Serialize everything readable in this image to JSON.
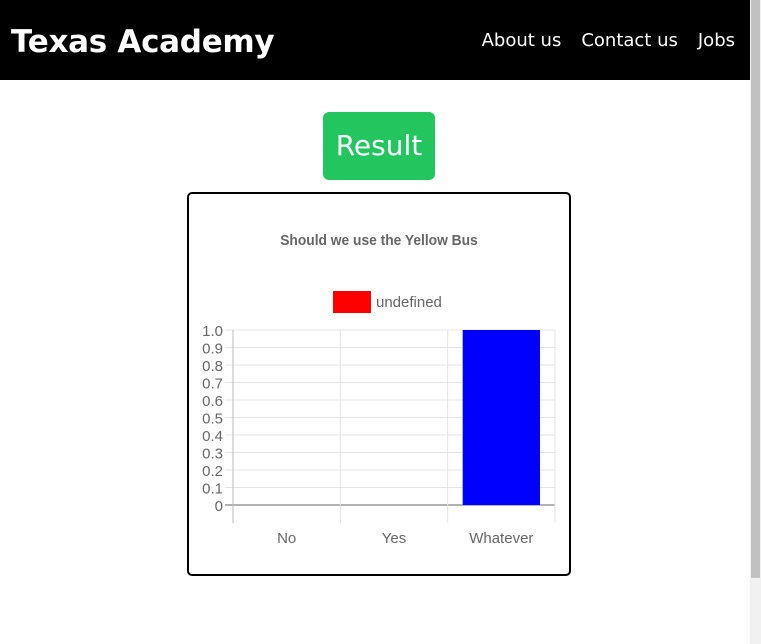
{
  "navbar": {
    "brand": "Texas Academy",
    "links": [
      {
        "label": "About us"
      },
      {
        "label": "Contact us"
      },
      {
        "label": "Jobs"
      }
    ]
  },
  "result_button": {
    "label": "Result",
    "color": "#22c55e"
  },
  "chart_data": {
    "type": "bar",
    "title": "Should we use the Yellow Bus",
    "legend": {
      "position": "top",
      "entries": [
        {
          "label": "undefined",
          "color": "#ff0000"
        }
      ]
    },
    "categories": [
      "No",
      "Yes",
      "Whatever"
    ],
    "series": [
      {
        "name": "undefined",
        "values": [
          0,
          0,
          1
        ],
        "colors": [
          "#ff0000",
          "#ff0000",
          "#0000ff"
        ]
      }
    ],
    "yticks": [
      "0",
      "0.1",
      "0.2",
      "0.3",
      "0.4",
      "0.5",
      "0.6",
      "0.7",
      "0.8",
      "0.9",
      "1.0"
    ],
    "ylim": [
      0,
      1
    ],
    "grid": true
  }
}
